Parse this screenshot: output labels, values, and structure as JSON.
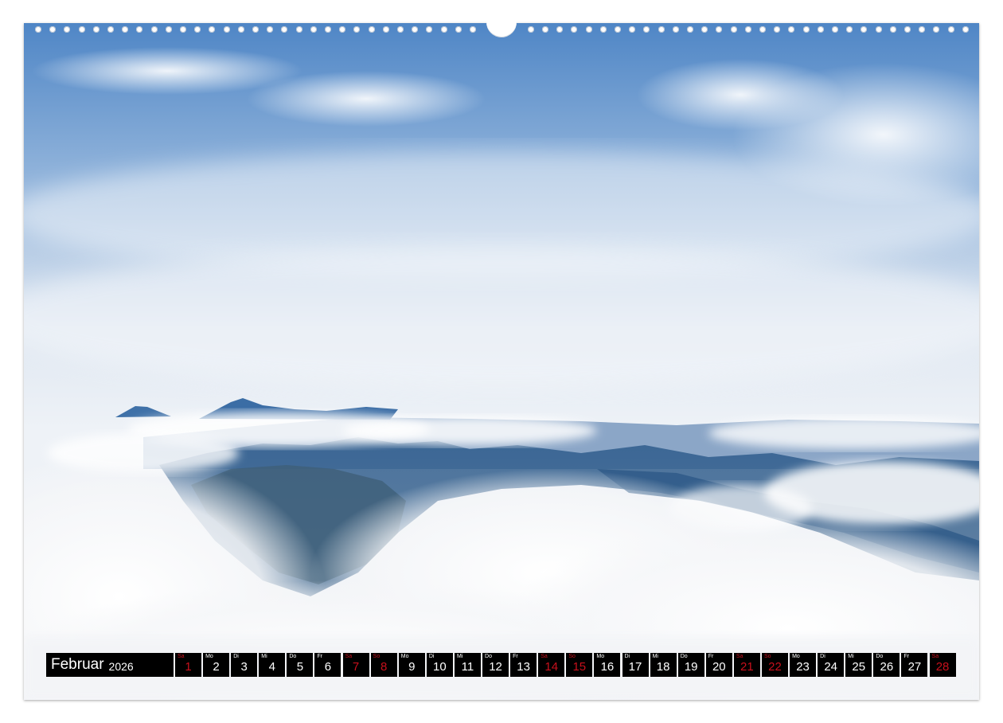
{
  "calendar": {
    "month": "Februar",
    "year": "2026",
    "days": [
      {
        "wd": "Sa",
        "num": "1",
        "weekend": true
      },
      {
        "wd": "Mo",
        "num": "2",
        "weekend": false
      },
      {
        "wd": "Di",
        "num": "3",
        "weekend": false
      },
      {
        "wd": "Mi",
        "num": "4",
        "weekend": false
      },
      {
        "wd": "Do",
        "num": "5",
        "weekend": false
      },
      {
        "wd": "Fr",
        "num": "6",
        "weekend": false
      },
      {
        "wd": "Sa",
        "num": "7",
        "weekend": true
      },
      {
        "wd": "So",
        "num": "8",
        "weekend": true
      },
      {
        "wd": "Mo",
        "num": "9",
        "weekend": false
      },
      {
        "wd": "Di",
        "num": "10",
        "weekend": false
      },
      {
        "wd": "Mi",
        "num": "11",
        "weekend": false
      },
      {
        "wd": "Do",
        "num": "12",
        "weekend": false
      },
      {
        "wd": "Fr",
        "num": "13",
        "weekend": false
      },
      {
        "wd": "Sa",
        "num": "14",
        "weekend": true
      },
      {
        "wd": "So",
        "num": "15",
        "weekend": true
      },
      {
        "wd": "Mo",
        "num": "16",
        "weekend": false
      },
      {
        "wd": "Di",
        "num": "17",
        "weekend": false
      },
      {
        "wd": "Mi",
        "num": "18",
        "weekend": false
      },
      {
        "wd": "Do",
        "num": "19",
        "weekend": false
      },
      {
        "wd": "Fr",
        "num": "20",
        "weekend": false
      },
      {
        "wd": "Sa",
        "num": "21",
        "weekend": true
      },
      {
        "wd": "So",
        "num": "22",
        "weekend": true
      },
      {
        "wd": "Mo",
        "num": "23",
        "weekend": false
      },
      {
        "wd": "Di",
        "num": "24",
        "weekend": false
      },
      {
        "wd": "Mi",
        "num": "25",
        "weekend": false
      },
      {
        "wd": "Do",
        "num": "26",
        "weekend": false
      },
      {
        "wd": "Fr",
        "num": "27",
        "weekend": false
      },
      {
        "wd": "Sa",
        "num": "28",
        "weekend": true
      }
    ]
  },
  "colors": {
    "sky_top": "#4f86c6",
    "cloud": "#f4f6f9",
    "mountain": "#2f5d8a",
    "weekend_red": "#c8101c"
  }
}
